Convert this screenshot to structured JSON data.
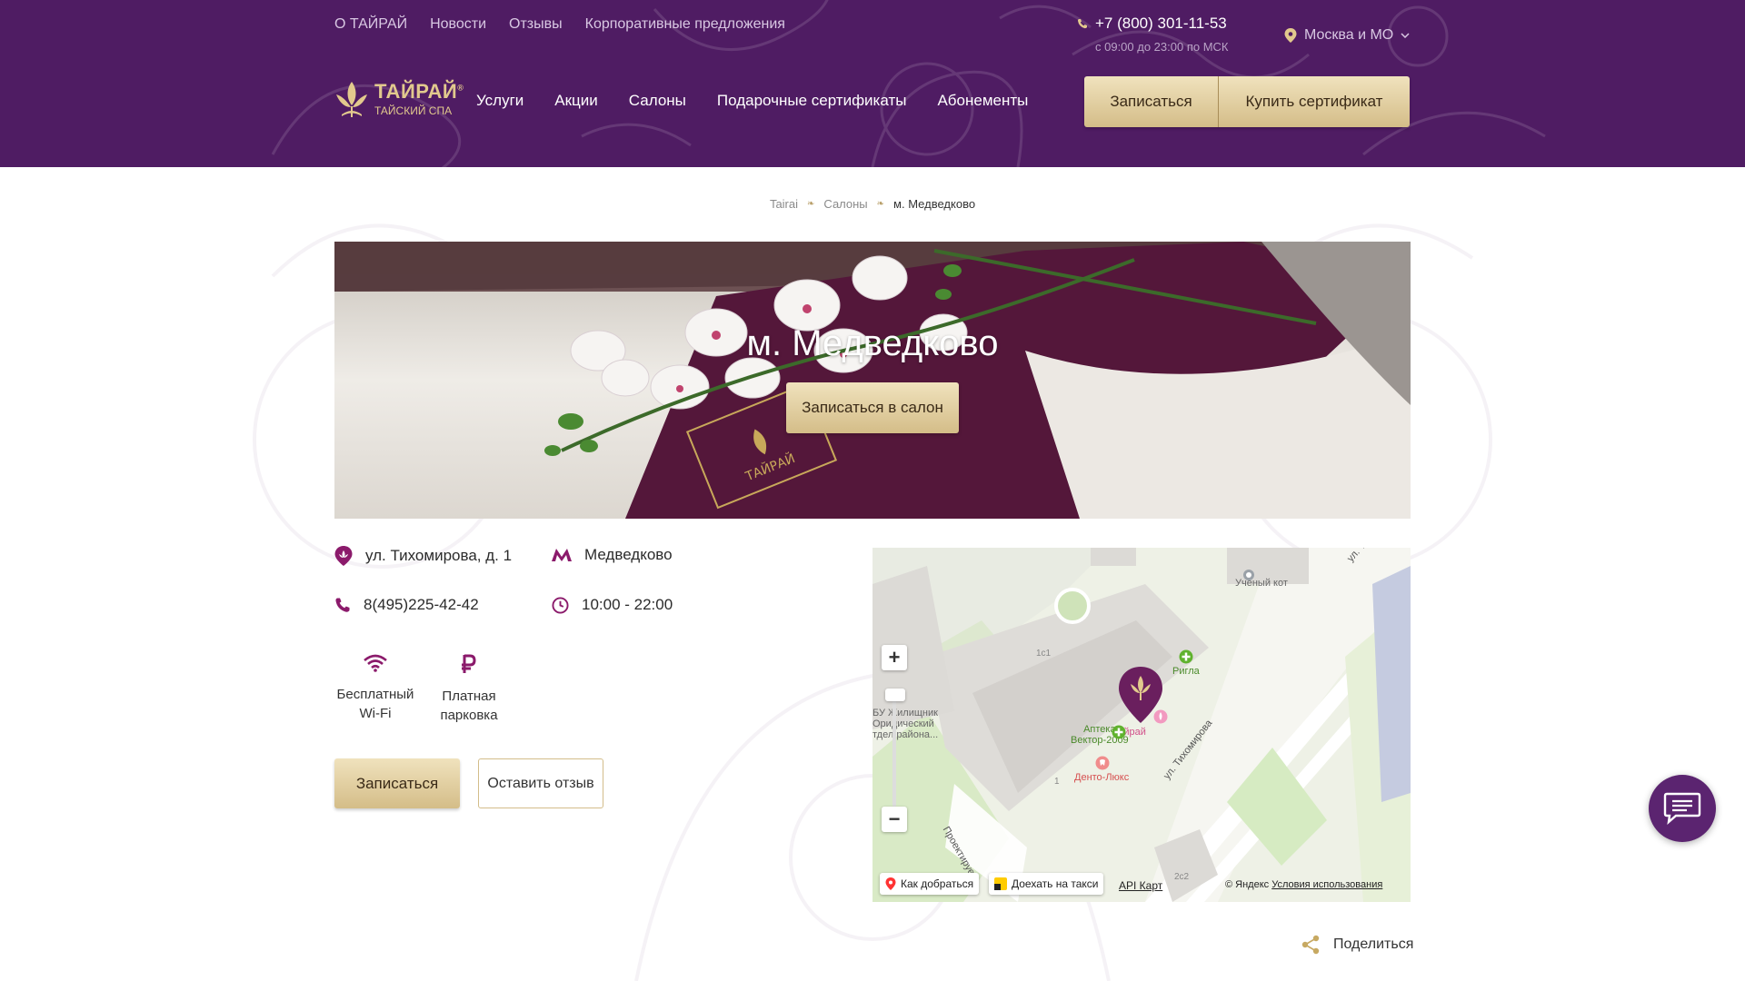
{
  "topnav": {
    "items": [
      "О ТАЙРАЙ",
      "Новости",
      "Отзывы",
      "Корпоративные предложения"
    ]
  },
  "contact": {
    "phone": "+7 (800) 301-11-53",
    "hours": "с 09:00 до 23:00 по МСК"
  },
  "region": {
    "label": "Москва и МО"
  },
  "logo": {
    "brand": "ТАЙРАЙ",
    "sub": "ТАЙСКИЙ СПА",
    "reg": "®"
  },
  "mainnav": {
    "items": [
      "Услуги",
      "Акции",
      "Салоны",
      "Подарочные сертификаты",
      "Абонементы"
    ]
  },
  "header_buttons": {
    "book": "Записаться",
    "buy_cert": "Купить сертификат"
  },
  "breadcrumb": {
    "items": [
      "Tairai",
      "Салоны",
      "м. Медведково"
    ],
    "sep": "❧"
  },
  "hero": {
    "title": "м. Медведково",
    "button": "Записаться в салон",
    "box_text": "ТАЙРАЙ"
  },
  "salon": {
    "address": "ул. Тихомирова, д. 1",
    "metro": "Медведково",
    "phone": "8(495)225-42-42",
    "hours": "10:00 - 22:00"
  },
  "amenities": [
    {
      "icon": "wifi-icon",
      "line1": "Бесплатный",
      "line2": "Wi-Fi"
    },
    {
      "icon": "ruble-icon",
      "line1": "Платная",
      "line2": "парковка"
    }
  ],
  "actions": {
    "book": "Записаться",
    "review": "Оставить отзыв"
  },
  "map": {
    "zoom_in": "+",
    "zoom_out": "−",
    "labels": {
      "cat": "Ученый кот",
      "street1": "ул. Тихом.",
      "street2": "ул. Тихомирова",
      "street3": "Проектируем.",
      "rigla": "Ригла",
      "apteka1": "Аптека",
      "apteka2": "Вектор-2009",
      "tairai": "Тайрай",
      "dento": "Денто-Люкс",
      "org1": "БУ Жилищник",
      "org2": "Оридический",
      "org3": "тдел района...",
      "bld1": "1с1",
      "bld2": "1",
      "bld3": "2с2"
    },
    "route": "Как добраться",
    "taxi": "Доехать на такси",
    "api": "API Карт",
    "copyright": "© Яндекс",
    "terms": "Условия использования"
  },
  "share": {
    "label": "Поделиться"
  },
  "colors": {
    "header_bg": "#4f1c63",
    "gold": "#d4bd88",
    "accent": "#8b1a6b"
  }
}
